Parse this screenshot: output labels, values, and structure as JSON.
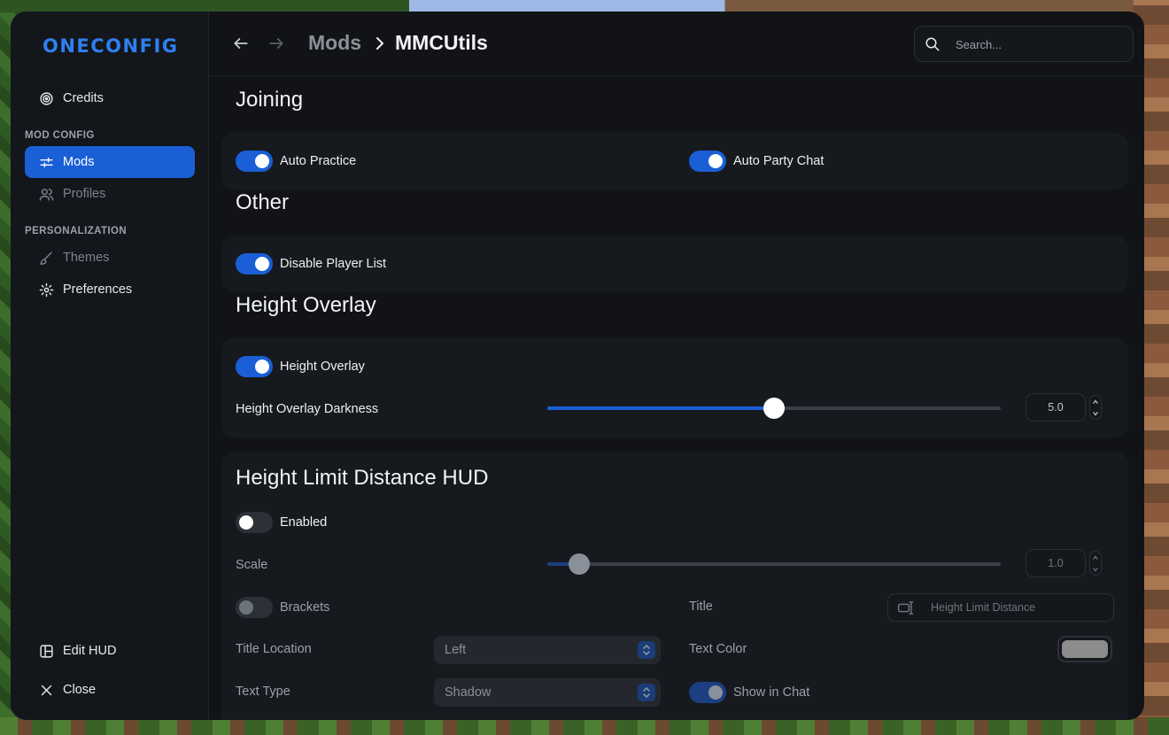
{
  "app": {
    "logo": "ONECONFIG"
  },
  "sidebar": {
    "credits": "Credits",
    "section_mod_config": "MOD CONFIG",
    "mods": "Mods",
    "profiles": "Profiles",
    "section_personalization": "PERSONALIZATION",
    "themes": "Themes",
    "preferences": "Preferences",
    "edit_hud": "Edit HUD",
    "close": "Close"
  },
  "header": {
    "breadcrumb_parent": "Mods",
    "breadcrumb_current": "MMCUtils",
    "search_placeholder": "Search..."
  },
  "sections": {
    "joining": {
      "title": "Joining",
      "auto_practice": {
        "label": "Auto Practice",
        "enabled": true
      },
      "auto_party_chat": {
        "label": "Auto Party Chat",
        "enabled": true
      }
    },
    "other": {
      "title": "Other",
      "disable_player_list": {
        "label": "Disable Player List",
        "enabled": true
      }
    },
    "height_overlay": {
      "title": "Height Overlay",
      "height_overlay": {
        "label": "Height Overlay",
        "enabled": true
      },
      "darkness": {
        "label": "Height Overlay Darkness",
        "value": "5.0",
        "fraction": 0.5
      }
    },
    "hud": {
      "title": "Height Limit Distance HUD",
      "enabled": {
        "label": "Enabled",
        "enabled": false
      },
      "scale": {
        "label": "Scale",
        "value": "1.0",
        "fraction": 0.07
      },
      "brackets": {
        "label": "Brackets",
        "enabled": false
      },
      "title_field": {
        "label": "Title",
        "value": "Height Limit Distance"
      },
      "title_location": {
        "label": "Title Location",
        "value": "Left"
      },
      "text_color": {
        "label": "Text Color",
        "color": "#8c8c8c"
      },
      "text_type": {
        "label": "Text Type",
        "value": "Shadow"
      },
      "show_in_chat": {
        "label": "Show in Chat",
        "enabled": true
      }
    }
  },
  "colors": {
    "accent": "#1a5fd6",
    "background": "#111317",
    "card": "#16191e"
  }
}
